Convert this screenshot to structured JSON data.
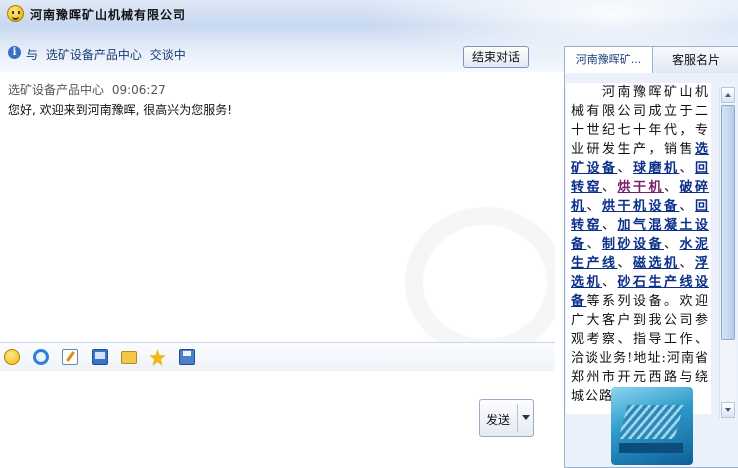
{
  "header": {
    "company_name": "河南豫晖矿山机械有限公司",
    "chat_with_prefix": "与",
    "chat_with_name": "选矿设备产品中心",
    "chat_with_suffix": "交谈中",
    "end_button": "结束对话"
  },
  "messages": [
    {
      "sender": "选矿设备产品中心",
      "time": "09:06:27",
      "text": "您好, 欢迎来到河南豫晖, 很高兴为您服务!"
    }
  ],
  "toolbar": {
    "icons": [
      "smiley-icon",
      "ie-icon",
      "note-icon",
      "screenshot-icon",
      "folder-icon",
      "star-icon",
      "save-icon"
    ]
  },
  "send": {
    "label": "发送"
  },
  "side_panel": {
    "tabs": [
      "河南豫晖矿...",
      "客服名片"
    ],
    "intro": {
      "lead": "　　河南豫晖矿山机械有限公司成立于二十世纪七十年代，专业研发生产，销售",
      "links": [
        "选矿设备",
        "球磨机",
        "回转窑",
        "烘干机",
        "破碎机",
        "烘干机设备",
        "回转窑",
        "加气混凝土设备",
        "制砂设备",
        "水泥生产线",
        "磁选机",
        "浮选机",
        "砂石生产线设备"
      ],
      "tail": "等系列设备。欢迎广大客户到我公司参观考察、指导工作、洽谈业务!地址:河南省郑州市开元西路与绕城公路交叉口"
    }
  },
  "colors": {
    "link": "#0b2f8a",
    "visited_link": "#7a1d6a",
    "header_text": "#1a3c78"
  }
}
